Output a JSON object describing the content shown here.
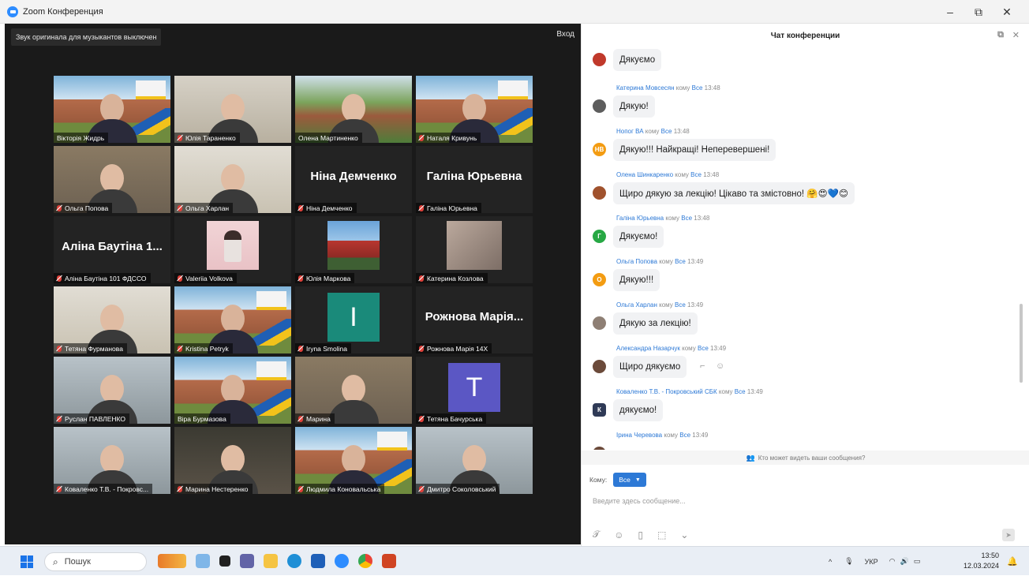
{
  "window": {
    "title": "Zoom Конференция",
    "minimize": "–",
    "restore": "⧉",
    "close": "✕"
  },
  "meeting": {
    "banner": "Звук оригинала для музыкантов выключен",
    "enter": "Вход",
    "participants": [
      {
        "name": "Вікторія Жидрь",
        "kind": "castle",
        "muted": false
      },
      {
        "name": "Юлія Тараненко",
        "kind": "room2",
        "muted": true
      },
      {
        "name": "Олена Мартиненко",
        "kind": "trees",
        "muted": false
      },
      {
        "name": "Наталя Кривунь",
        "kind": "castle",
        "muted": true
      },
      {
        "name": "Ольга Попова",
        "kind": "room",
        "muted": true
      },
      {
        "name": "Ольга Харлан",
        "kind": "room5",
        "muted": true
      },
      {
        "name": "Ніна Демченко",
        "kind": "text",
        "bigname": "Ніна Демченко",
        "muted": true
      },
      {
        "name": "Галіна Юрьевна",
        "kind": "text",
        "bigname": "Галіна Юрьевна",
        "muted": true
      },
      {
        "name": "Аліна Баутіна 101 ФДССО",
        "kind": "text",
        "bigname": "Аліна Баутіна 1...",
        "muted": true
      },
      {
        "name": "Valeriia Volkova",
        "kind": "pink",
        "muted": true
      },
      {
        "name": "Юлія Маркова",
        "kind": "city",
        "muted": true
      },
      {
        "name": "Катерина Козлова",
        "kind": "girl",
        "muted": true
      },
      {
        "name": "Тетяна Фурманова",
        "kind": "room5",
        "muted": true
      },
      {
        "name": "Kristina Petryk",
        "kind": "castle",
        "muted": true
      },
      {
        "name": "Iryna Smolina",
        "kind": "avatar",
        "letter": "I",
        "color": "#1a8a7a",
        "muted": true
      },
      {
        "name": "Рожнова Марія 14Х",
        "kind": "text",
        "bigname": "Рожнова Марія...",
        "muted": true
      },
      {
        "name": "Руслан ПАВЛЕНКО",
        "kind": "room3",
        "muted": true
      },
      {
        "name": "Віра Бурмазова",
        "kind": "castle",
        "muted": false,
        "active": true
      },
      {
        "name": "Марина",
        "kind": "room",
        "muted": true
      },
      {
        "name": "Тетяна Бачурська",
        "kind": "avatar",
        "letter": "T",
        "color": "#5b57c4",
        "muted": true
      },
      {
        "name": "Коваленко Т.В. - Покровс...",
        "kind": "room3",
        "muted": true
      },
      {
        "name": "Марина Нестеренко",
        "kind": "room4",
        "muted": true
      },
      {
        "name": "Людмила Коновальська",
        "kind": "castle",
        "muted": true
      },
      {
        "name": "Дмитро Соколовський",
        "kind": "room3",
        "muted": true
      }
    ]
  },
  "chat": {
    "title": "Чат конференции",
    "popout_icon": "popout-icon",
    "close_icon": "close-icon",
    "to_word": "кому",
    "messages": [
      {
        "sender": "",
        "to": "",
        "time": "",
        "text": "Дякуємо",
        "avatar": "",
        "avatar_color": "#c0392b"
      },
      {
        "sender": "Катерина Мовсесян",
        "to": "Все",
        "time": "13:48",
        "text": "Дякую!",
        "avatar": "",
        "avatar_color": "#5d5d5d"
      },
      {
        "sender": "Нопог ВА",
        "to": "Все",
        "time": "13:48",
        "text": "Дякую!!! Найкращі! Неперевершені!",
        "avatar": "НВ",
        "avatar_color": "#f39c12"
      },
      {
        "sender": "Олена Шинкаренко",
        "to": "Все",
        "time": "13:48",
        "text": "Щиро дякую за лекцію! Цікаво та змістовно! 🤗😍💙😊",
        "avatar": "",
        "avatar_color": "#a0522d"
      },
      {
        "sender": "Галіна Юрьевна",
        "to": "Все",
        "time": "13:48",
        "text": "Дякуємо!",
        "avatar": "Г",
        "avatar_color": "#27a844"
      },
      {
        "sender": "Ольга Попова",
        "to": "Все",
        "time": "13:49",
        "text": "Дякую!!!",
        "avatar": "О",
        "avatar_color": "#f39c12"
      },
      {
        "sender": "Ольга Харлан",
        "to": "Все",
        "time": "13:49",
        "text": "Дякую за лекцію!",
        "avatar": "",
        "avatar_color": "#8e7f74"
      },
      {
        "sender": "Александра Назарчук",
        "to": "Все",
        "time": "13:49",
        "text": "Щиро дякуємо",
        "avatar": "",
        "avatar_color": "#6b4a3a"
      },
      {
        "sender": "Коваленко Т.В. - Покровський СБК",
        "to": "Все",
        "time": "13:49",
        "text": "дякуємо!",
        "avatar": "К",
        "avatar_color": "#2f3a56"
      },
      {
        "sender": "Ірина Черевова",
        "to": "Все",
        "time": "13:49",
        "text": "",
        "avatar": "",
        "avatar_color": "#6b4a3a"
      }
    ],
    "privacy_note": "Кто может видеть ваши сообщения?",
    "to_label": "Кому:",
    "to_value": "Все",
    "input_placeholder": "Введите здесь сообщение..."
  },
  "taskbar": {
    "search_placeholder": "Пошук",
    "lang": "УКР",
    "time": "13:50",
    "date": "12.03.2024",
    "chevron": "^"
  }
}
